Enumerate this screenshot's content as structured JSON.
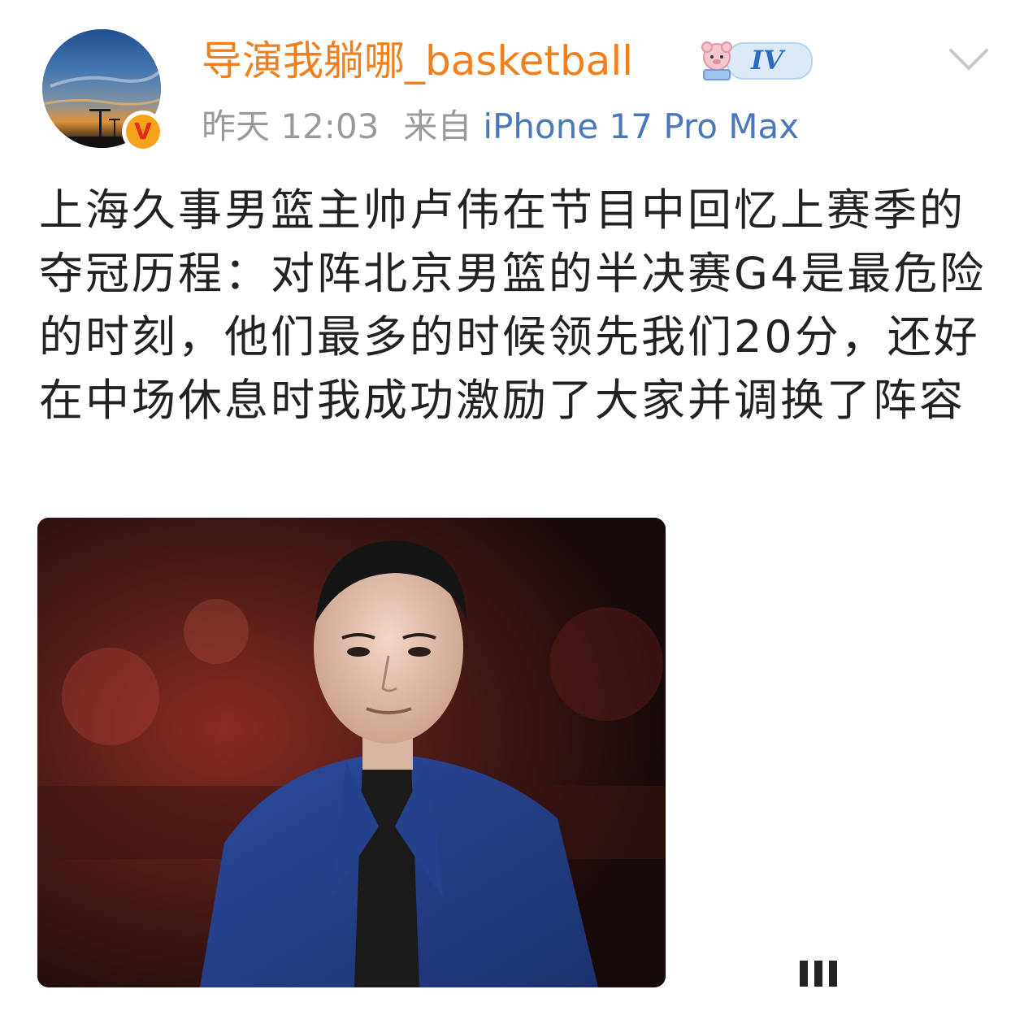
{
  "post": {
    "author": {
      "name": "导演我躺哪_basketball",
      "verified_label": "V",
      "level_label": "IV"
    },
    "meta": {
      "time": "昨天 12:03",
      "source_prefix": "来自",
      "device": "iPhone 17 Pro Max"
    },
    "text": "上海久事男篮主帅卢伟在节目中回忆上赛季的夺冠历程：对阵北京男篮的半决赛G4是最危险的时刻，他们最多的时候领先我们20分，还好在中场休息时我成功激励了大家并调换了阵容"
  },
  "colors": {
    "username": "#f0801e",
    "device_link": "#4a78b8",
    "meta_gray": "#9a9a9a",
    "body_text": "#222222"
  },
  "icons": {
    "more": "chevron-down-icon",
    "verified": "verified-v-icon",
    "level": "level-badge-icon"
  }
}
